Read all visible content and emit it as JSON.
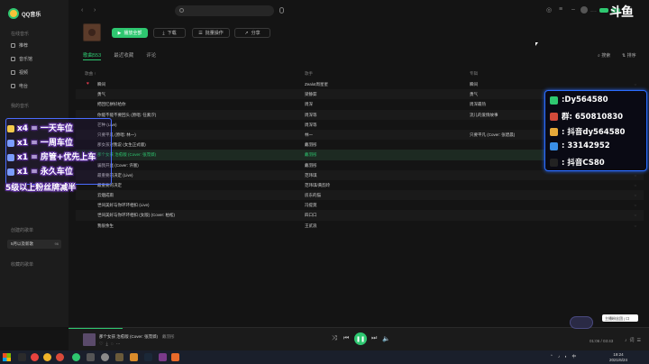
{
  "app": {
    "name": "QQ音乐"
  },
  "sidebar": {
    "section_online": "在线音乐",
    "items": [
      "推荐",
      "音乐馆",
      "视频",
      "电台"
    ],
    "section_mine": "我的音乐",
    "section_created": "创建的歌单",
    "highlight_playlist": "5月以及新歌",
    "highlight_count": "96",
    "section_collected": "收藏的歌单"
  },
  "topbar": {
    "search_placeholder": "",
    "user_name": "......"
  },
  "album": {
    "play_all": "播放全部",
    "download": "下载",
    "batch": "批量操作",
    "share": "分享"
  },
  "tabs": {
    "songs": "歌曲553",
    "recent": "最近收藏",
    "comments": "评论",
    "search": "搜索",
    "sort": "排序"
  },
  "table": {
    "headers": {
      "title": "歌曲 ↑",
      "artist": "歌手",
      "album": "专辑"
    },
    "rows": [
      {
        "title": "瞬间",
        "artist": "Zealot周星星",
        "album": "瞬间",
        "heart": true
      },
      {
        "title": "勇气",
        "artist": "梁静茹",
        "album": "勇气"
      },
      {
        "title": "把回忆拼好给你",
        "artist": "周深",
        "album": "周深最热"
      },
      {
        "title": "你能不能不要回头 (原唱: 任素汐)",
        "artist": "周深等",
        "album": "流儿的爱情故事"
      },
      {
        "title": "芒种 (Live)",
        "artist": "周深等",
        "album": ""
      },
      {
        "title": "只要平凡 (原唱: 林一)",
        "artist": "林一",
        "album": "只要平凡 (Cover: 张碧晨)"
      },
      {
        "title": "那女孩对我说 (女生正式版)",
        "artist": "戴羽彤",
        "album": ""
      },
      {
        "title": "那个女孩 治愈版 (Cover: 张茂骅)",
        "artist": "戴羽彤",
        "album": "",
        "playing": true
      },
      {
        "title": "骗我开直 (Cover: 许嵩)",
        "artist": "戴羽彤",
        "album": ""
      },
      {
        "title": "最重要的决定 (Live)",
        "artist": "范玮琪",
        "album": ""
      },
      {
        "title": "最重要的决定",
        "artist": "范玮琪/黄韵玲",
        "album": ""
      },
      {
        "title": "云烟成雨",
        "artist": "房东的猫",
        "album": ""
      },
      {
        "title": "世间美好与你环环相扣 (Live)",
        "artist": "冯提莫",
        "album": ""
      },
      {
        "title": "世间美好与你环环相扣 (女版) (Cover: 柏松)",
        "artist": "四口口",
        "album": ""
      },
      {
        "title": "我很余生",
        "artist": "王贰浪",
        "album": ""
      }
    ]
  },
  "player": {
    "title": "那个女孩 治愈版 (Cover: 张茂骅)",
    "artist": "戴羽彤",
    "time": "01:06 / 03:43",
    "progress": 0.3
  },
  "overlay_left": {
    "lines": [
      "x4 = 一天车位",
      "x1 = 一周车位",
      "x1 = 房管+优先上车",
      "x1 = 永久车位",
      "5级以上粉丝牌减半"
    ]
  },
  "overlay_right": {
    "rows": [
      {
        "text": ":Dy564580",
        "color": "#2ec770"
      },
      {
        "text": "群: 650810830",
        "color": "#d24a3a"
      },
      {
        "text": ": 抖音dy564580",
        "color": "#e6a93a"
      },
      {
        "text": ": 33142952",
        "color": "#3a8fe6"
      },
      {
        "text": ": 抖音CS80",
        "color": "#222222"
      }
    ]
  },
  "mini_tip": "主播粉丝团 | 口",
  "clock": {
    "time": "19:24",
    "date": "2021/6/24"
  },
  "colors": {
    "accent": "#2ec770",
    "bg": "#141414",
    "heart": "#e23a4e"
  }
}
